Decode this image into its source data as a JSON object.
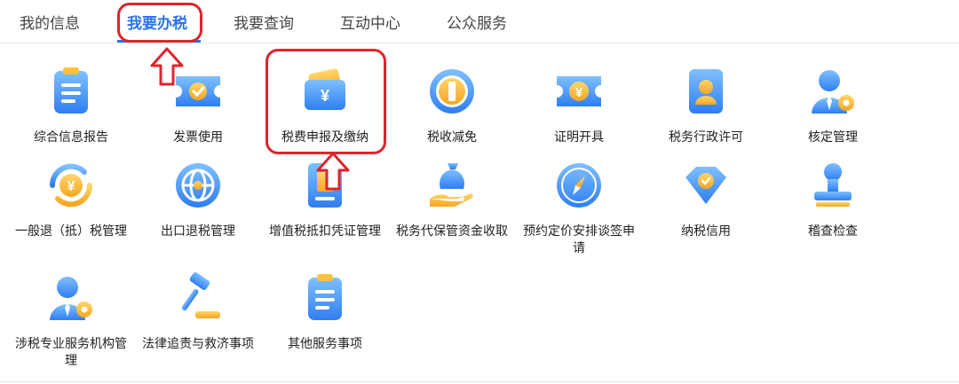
{
  "tabs": [
    {
      "label": "我的信息"
    },
    {
      "label": "我要办税"
    },
    {
      "label": "我要查询"
    },
    {
      "label": "互动中心"
    },
    {
      "label": "公众服务"
    }
  ],
  "services": [
    {
      "label": "综合信息报告",
      "icon": "document-list-icon"
    },
    {
      "label": "发票使用",
      "icon": "invoice-ticket-icon"
    },
    {
      "label": "税费申报及缴纳",
      "icon": "yuan-wallet-icon"
    },
    {
      "label": "税收减免",
      "icon": "tax-reduction-badge-icon"
    },
    {
      "label": "证明开具",
      "icon": "yuan-ticket-icon"
    },
    {
      "label": "税务行政许可",
      "icon": "license-person-icon"
    },
    {
      "label": "核定管理",
      "icon": "person-settings-icon"
    },
    {
      "label": "一般退（抵）税管理",
      "icon": "yuan-refund-cycle-icon"
    },
    {
      "label": "出口退税管理",
      "icon": "globe-icon"
    },
    {
      "label": "增值税抵扣凭证管理",
      "icon": "voucher-book-icon"
    },
    {
      "label": "税务代保管资金收取",
      "icon": "money-bag-hand-icon"
    },
    {
      "label": "预约定价安排谈签申请",
      "icon": "compass-icon"
    },
    {
      "label": "纳税信用",
      "icon": "diamond-check-icon"
    },
    {
      "label": "稽查检查",
      "icon": "stamp-icon"
    },
    {
      "label": "涉税专业服务机构管理",
      "icon": "person-settings-icon"
    },
    {
      "label": "法律追责与救济事项",
      "icon": "gavel-icon"
    },
    {
      "label": "其他服务事项",
      "icon": "document-list-icon"
    }
  ],
  "colors": {
    "accent": "#2b73e8",
    "highlight": "#e0242b",
    "icon_orange": "#f5a623"
  }
}
